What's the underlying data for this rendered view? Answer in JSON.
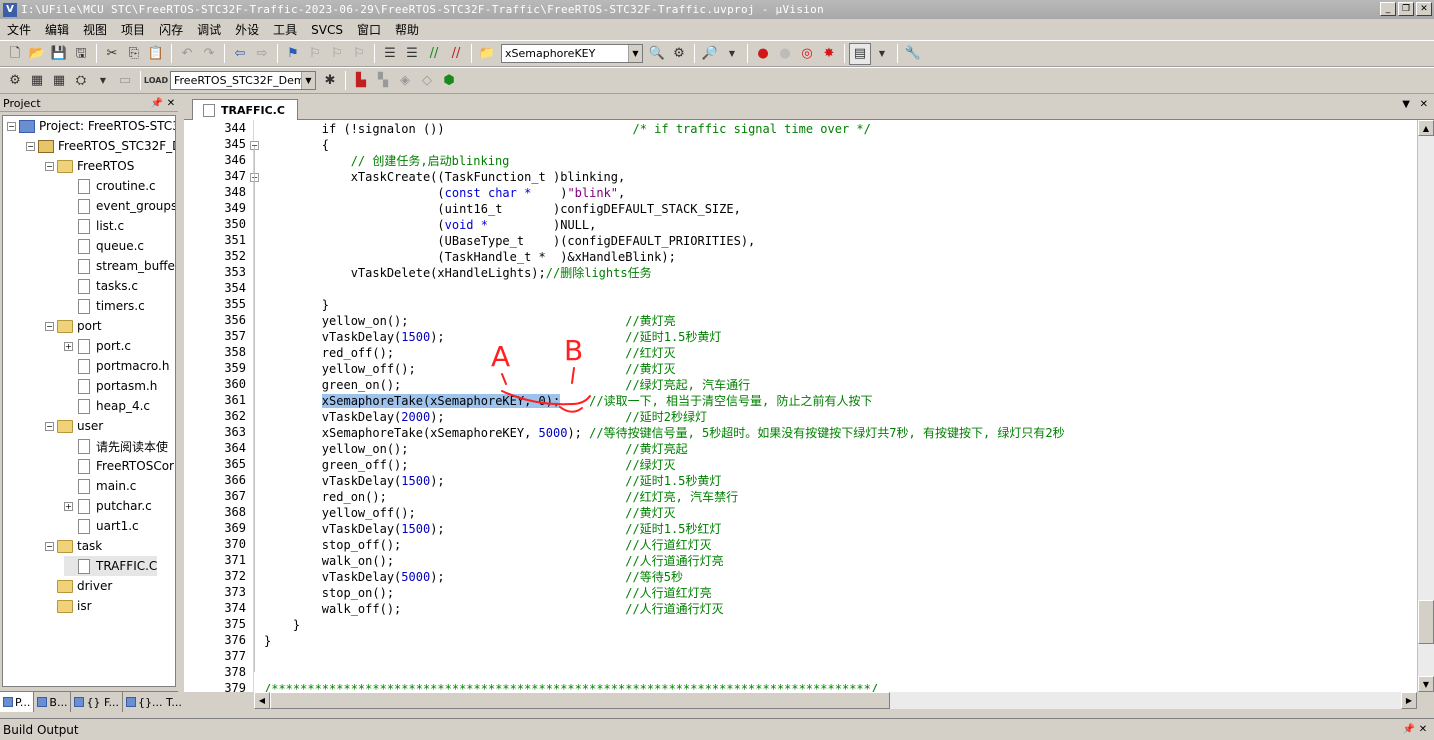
{
  "window": {
    "title": "I:\\UFile\\MCU STC\\FreeRTOS-STC32F-Traffic-2023-06-29\\FreeRTOS-STC32F-Traffic\\FreeRTOS-STC32F-Traffic.uvproj - µVision",
    "app_icon": "V"
  },
  "menu": [
    "文件",
    "编辑",
    "视图",
    "项目",
    "闪存",
    "调试",
    "外设",
    "工具",
    "SVCS",
    "窗口",
    "帮助"
  ],
  "toolbar": {
    "find_combo": "xSemaphoreKEY",
    "target_combo": "FreeRTOS_STC32F_Demo"
  },
  "project_panel": {
    "title": "Project",
    "tree": [
      {
        "label": "Project: FreeRTOS-STC32",
        "type": "proj",
        "depth": 0,
        "expander": "-"
      },
      {
        "label": "FreeRTOS_STC32F_De",
        "type": "target",
        "depth": 1,
        "expander": "-"
      },
      {
        "label": "FreeRTOS",
        "type": "folder",
        "depth": 2,
        "expander": "-"
      },
      {
        "label": "croutine.c",
        "type": "file",
        "depth": 3,
        "expander": ""
      },
      {
        "label": "event_groups",
        "type": "file",
        "depth": 3,
        "expander": ""
      },
      {
        "label": "list.c",
        "type": "file",
        "depth": 3,
        "expander": ""
      },
      {
        "label": "queue.c",
        "type": "file",
        "depth": 3,
        "expander": ""
      },
      {
        "label": "stream_buffer",
        "type": "file",
        "depth": 3,
        "expander": ""
      },
      {
        "label": "tasks.c",
        "type": "file",
        "depth": 3,
        "expander": ""
      },
      {
        "label": "timers.c",
        "type": "file",
        "depth": 3,
        "expander": ""
      },
      {
        "label": "port",
        "type": "folder",
        "depth": 2,
        "expander": "-"
      },
      {
        "label": "port.c",
        "type": "file",
        "depth": 3,
        "expander": "+"
      },
      {
        "label": "portmacro.h",
        "type": "file",
        "depth": 3,
        "expander": ""
      },
      {
        "label": "portasm.h",
        "type": "file",
        "depth": 3,
        "expander": ""
      },
      {
        "label": "heap_4.c",
        "type": "file",
        "depth": 3,
        "expander": ""
      },
      {
        "label": "user",
        "type": "folder",
        "depth": 2,
        "expander": "-"
      },
      {
        "label": "请先阅读本使",
        "type": "file",
        "depth": 3,
        "expander": ""
      },
      {
        "label": "FreeRTOSCor",
        "type": "file",
        "depth": 3,
        "expander": ""
      },
      {
        "label": "main.c",
        "type": "file",
        "depth": 3,
        "expander": ""
      },
      {
        "label": "putchar.c",
        "type": "file",
        "depth": 3,
        "expander": "+"
      },
      {
        "label": "uart1.c",
        "type": "file",
        "depth": 3,
        "expander": ""
      },
      {
        "label": "task",
        "type": "folder",
        "depth": 2,
        "expander": "-"
      },
      {
        "label": "TRAFFIC.C",
        "type": "file",
        "depth": 3,
        "expander": "",
        "selected": true
      },
      {
        "label": "driver",
        "type": "folder",
        "depth": 2,
        "expander": ""
      },
      {
        "label": "isr",
        "type": "folder",
        "depth": 2,
        "expander": ""
      }
    ],
    "tabs": [
      {
        "label": "P...",
        "icon": "project-tab-icon"
      },
      {
        "label": "B...",
        "icon": "books-tab-icon"
      },
      {
        "label": "{} F...",
        "icon": "functions-tab-icon"
      },
      {
        "label": "{}... T...",
        "icon": "templates-tab-icon"
      }
    ]
  },
  "editor": {
    "tab": "TRAFFIC.C",
    "lines": [
      {
        "n": "344",
        "fold": "",
        "t": [
          [
            "p",
            "        if (!signalon ())                          "
          ],
          [
            "c",
            "/* if traffic signal time over */"
          ]
        ]
      },
      {
        "n": "345",
        "fold": "-",
        "t": [
          [
            "p",
            "        {"
          ]
        ]
      },
      {
        "n": "346",
        "fold": "",
        "t": [
          [
            "p",
            "            "
          ],
          [
            "c",
            "// 创建任务,启动blinking"
          ]
        ]
      },
      {
        "n": "347",
        "fold": "-",
        "t": [
          [
            "p",
            "            xTaskCreate((TaskFunction_t )blinking,"
          ]
        ]
      },
      {
        "n": "348",
        "fold": "",
        "t": [
          [
            "p",
            "                        ("
          ],
          [
            "k",
            "const char *"
          ],
          [
            "p",
            "    )"
          ],
          [
            "s",
            "\"blink\""
          ],
          [
            "p",
            ","
          ]
        ]
      },
      {
        "n": "349",
        "fold": "",
        "t": [
          [
            "p",
            "                        (uint16_t       )configDEFAULT_STACK_SIZE,"
          ]
        ]
      },
      {
        "n": "350",
        "fold": "",
        "t": [
          [
            "p",
            "                        ("
          ],
          [
            "k",
            "void *"
          ],
          [
            "p",
            "         )NULL,"
          ]
        ]
      },
      {
        "n": "351",
        "fold": "",
        "t": [
          [
            "p",
            "                        (UBaseType_t    )(configDEFAULT_PRIORITIES),"
          ]
        ]
      },
      {
        "n": "352",
        "fold": "",
        "t": [
          [
            "p",
            "                        (TaskHandle_t *  )&xHandleBlink);"
          ]
        ]
      },
      {
        "n": "353",
        "fold": "",
        "t": [
          [
            "p",
            "            vTaskDelete(xHandleLights);"
          ],
          [
            "c",
            "//删除lights任务"
          ]
        ]
      },
      {
        "n": "354",
        "fold": "",
        "t": [
          [
            "p",
            ""
          ]
        ]
      },
      {
        "n": "355",
        "fold": "",
        "t": [
          [
            "p",
            "        }"
          ]
        ]
      },
      {
        "n": "356",
        "fold": "",
        "t": [
          [
            "p",
            "        yellow_on();                              "
          ],
          [
            "c",
            "//黄灯亮"
          ]
        ]
      },
      {
        "n": "357",
        "fold": "",
        "t": [
          [
            "p",
            "        vTaskDelay("
          ],
          [
            "n",
            "1500"
          ],
          [
            "p",
            ");                         "
          ],
          [
            "c",
            "//延时1.5秒黄灯"
          ]
        ]
      },
      {
        "n": "358",
        "fold": "",
        "t": [
          [
            "p",
            "        red_off();                                "
          ],
          [
            "c",
            "//红灯灭"
          ]
        ]
      },
      {
        "n": "359",
        "fold": "",
        "t": [
          [
            "p",
            "        yellow_off();                             "
          ],
          [
            "c",
            "//黄灯灭"
          ]
        ]
      },
      {
        "n": "360",
        "fold": "",
        "t": [
          [
            "p",
            "        green_on();                               "
          ],
          [
            "c",
            "//绿灯亮起, 汽车通行"
          ]
        ]
      },
      {
        "n": "361",
        "fold": "",
        "t": [
          [
            "h",
            "xSemaphoreTake(xSemaphoreKEY, 0);"
          ],
          [
            "p",
            "    "
          ],
          [
            "c",
            "//读取一下, 相当于清空信号量, 防止之前有人按下"
          ]
        ],
        "indent": "        "
      },
      {
        "n": "362",
        "fold": "",
        "t": [
          [
            "p",
            "        vTaskDelay("
          ],
          [
            "n",
            "2000"
          ],
          [
            "p",
            ");                         "
          ],
          [
            "c",
            "//延时2秒绿灯"
          ]
        ]
      },
      {
        "n": "363",
        "fold": "",
        "t": [
          [
            "p",
            "        xSemaphoreTake(xSemaphoreKEY, "
          ],
          [
            "n",
            "5000"
          ],
          [
            "p",
            "); "
          ],
          [
            "c",
            "//等待按键信号量, 5秒超时。如果没有按键按下绿灯共7秒, 有按键按下, 绿灯只有2秒"
          ]
        ]
      },
      {
        "n": "364",
        "fold": "",
        "t": [
          [
            "p",
            "        yellow_on();                              "
          ],
          [
            "c",
            "//黄灯亮起"
          ]
        ]
      },
      {
        "n": "365",
        "fold": "",
        "t": [
          [
            "p",
            "        green_off();                              "
          ],
          [
            "c",
            "//绿灯灭"
          ]
        ]
      },
      {
        "n": "366",
        "fold": "",
        "t": [
          [
            "p",
            "        vTaskDelay("
          ],
          [
            "n",
            "1500"
          ],
          [
            "p",
            ");                         "
          ],
          [
            "c",
            "//延时1.5秒黄灯"
          ]
        ]
      },
      {
        "n": "367",
        "fold": "",
        "t": [
          [
            "p",
            "        red_on();                                 "
          ],
          [
            "c",
            "//红灯亮, 汽车禁行"
          ]
        ]
      },
      {
        "n": "368",
        "fold": "",
        "t": [
          [
            "p",
            "        yellow_off();                             "
          ],
          [
            "c",
            "//黄灯灭"
          ]
        ]
      },
      {
        "n": "369",
        "fold": "",
        "t": [
          [
            "p",
            "        vTaskDelay("
          ],
          [
            "n",
            "1500"
          ],
          [
            "p",
            ");                         "
          ],
          [
            "c",
            "//延时1.5秒红灯"
          ]
        ]
      },
      {
        "n": "370",
        "fold": "",
        "t": [
          [
            "p",
            "        stop_off();                               "
          ],
          [
            "c",
            "//人行道红灯灭"
          ]
        ]
      },
      {
        "n": "371",
        "fold": "",
        "t": [
          [
            "p",
            "        walk_on();                                "
          ],
          [
            "c",
            "//人行道通行灯亮"
          ]
        ]
      },
      {
        "n": "372",
        "fold": "",
        "t": [
          [
            "p",
            "        vTaskDelay("
          ],
          [
            "n",
            "5000"
          ],
          [
            "p",
            ");                         "
          ],
          [
            "c",
            "//等待5秒"
          ]
        ]
      },
      {
        "n": "373",
        "fold": "",
        "t": [
          [
            "p",
            "        stop_on();                                "
          ],
          [
            "c",
            "//人行道红灯亮"
          ]
        ]
      },
      {
        "n": "374",
        "fold": "",
        "t": [
          [
            "p",
            "        walk_off();                               "
          ],
          [
            "c",
            "//人行道通行灯灭"
          ]
        ]
      },
      {
        "n": "375",
        "fold": "",
        "t": [
          [
            "p",
            "    }"
          ]
        ]
      },
      {
        "n": "376",
        "fold": "",
        "t": [
          [
            "p",
            "}"
          ]
        ]
      },
      {
        "n": "377",
        "fold": "",
        "t": [
          [
            "p",
            ""
          ]
        ]
      },
      {
        "n": "378",
        "fold": "",
        "t": [
          [
            "p",
            ""
          ]
        ]
      },
      {
        "n": "379",
        "fold": "",
        "t": [
          [
            "c",
            "/***********************************************************************************/"
          ]
        ],
        "indent": ""
      }
    ]
  },
  "annotations": {
    "a": "A",
    "b": "B",
    "color": "#ff2020"
  },
  "build_output": {
    "title": "Build Output"
  }
}
